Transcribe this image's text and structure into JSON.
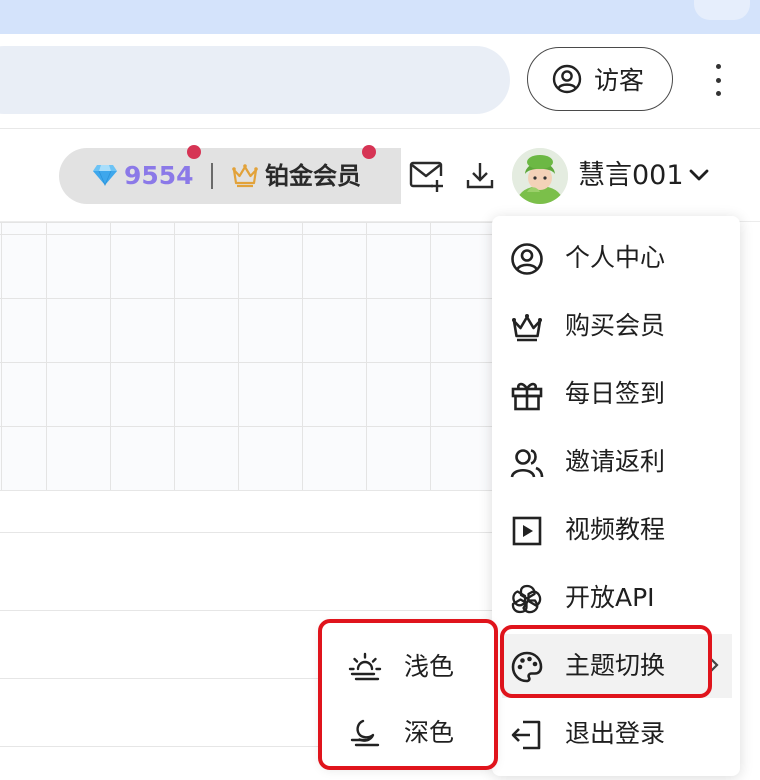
{
  "browser": {
    "profile_label": "访客",
    "profile_icon": "account-circle-icon",
    "menu_icon": "kebab-icon"
  },
  "header": {
    "points": "9554",
    "membership": "铂金会员",
    "username": "慧言001",
    "icons": [
      "gem-icon",
      "crown-icon",
      "mail-plus-icon",
      "download-icon",
      "avatar",
      "chevron-down-icon"
    ],
    "colors": {
      "points": "#8b79e8",
      "notification_dot": "#d63454",
      "crown": "#e2a23a"
    }
  },
  "menu": {
    "items": [
      {
        "label": "个人中心",
        "icon": "user-circle-icon"
      },
      {
        "label": "购买会员",
        "icon": "crown-icon"
      },
      {
        "label": "每日签到",
        "icon": "gift-icon"
      },
      {
        "label": "邀请返利",
        "icon": "users-icon"
      },
      {
        "label": "视频教程",
        "icon": "play-square-icon"
      },
      {
        "label": "开放API",
        "icon": "openai-icon"
      },
      {
        "label": "主题切换",
        "icon": "palette-icon",
        "has_submenu": true
      },
      {
        "label": "退出登录",
        "icon": "logout-icon"
      }
    ]
  },
  "theme_submenu": {
    "items": [
      {
        "label": "浅色",
        "icon": "sun-haze-icon"
      },
      {
        "label": "深色",
        "icon": "moon-haze-icon"
      }
    ]
  },
  "highlight_color": "#e0141c"
}
